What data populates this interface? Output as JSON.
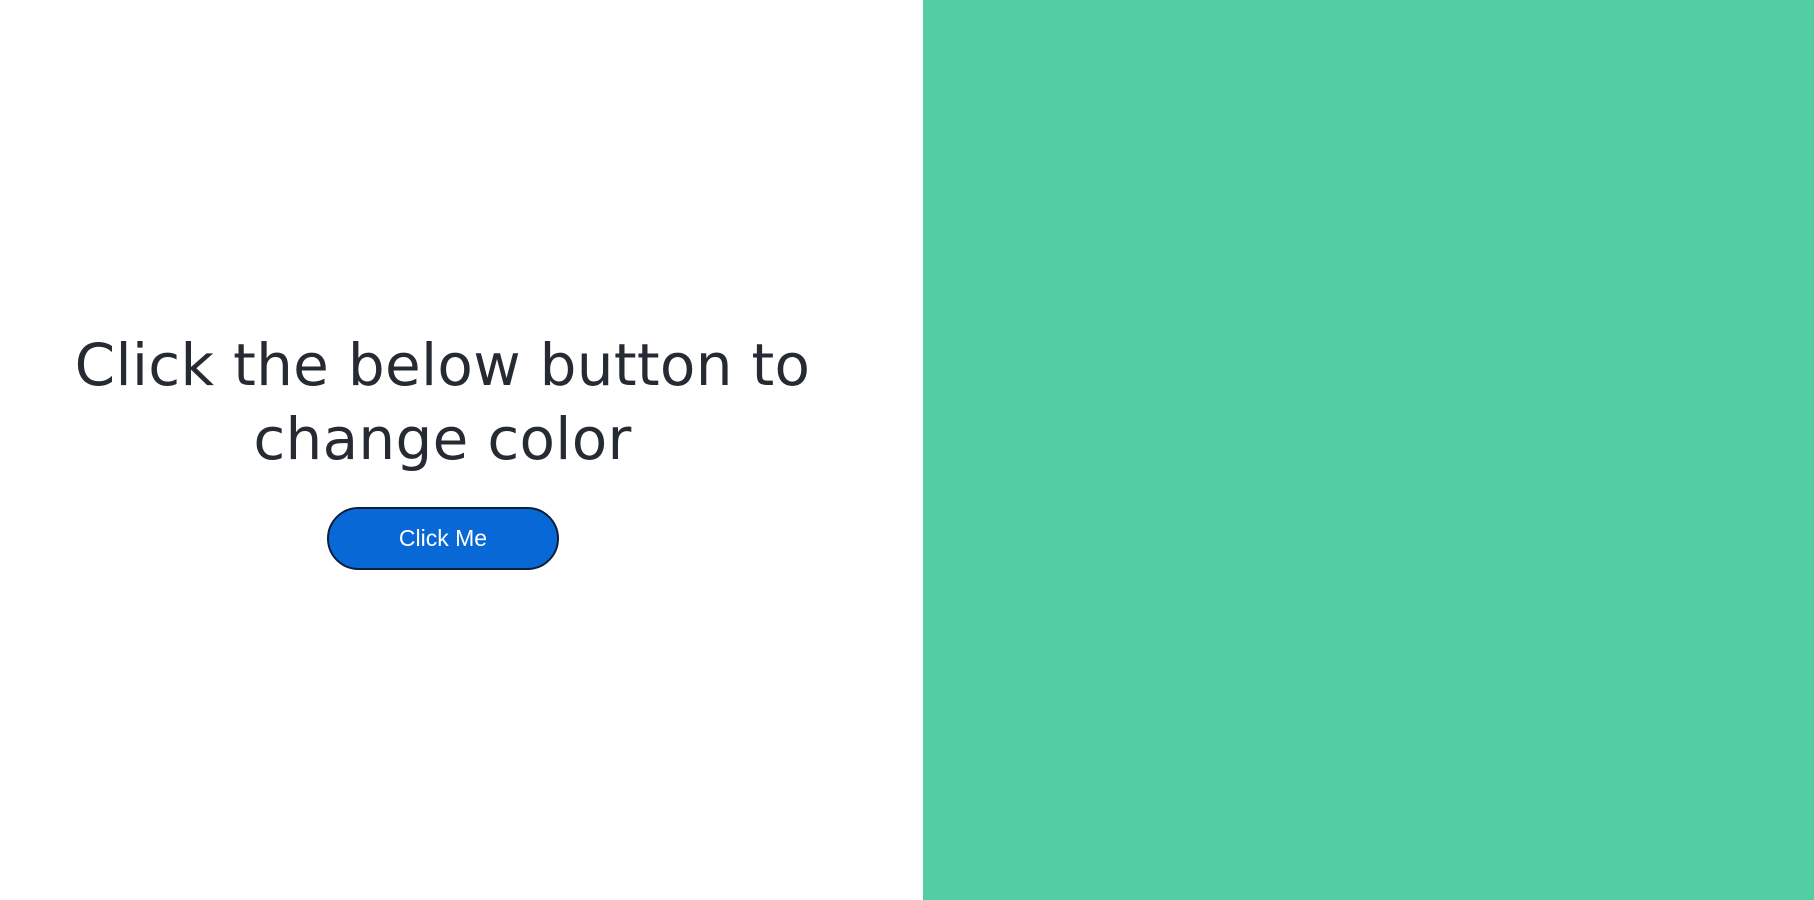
{
  "main": {
    "heading": "Click the below button to change color",
    "button_label": "Click Me"
  },
  "colors": {
    "panel_background": "#53cda3",
    "button_background": "#0868d6",
    "heading_text": "#262a33"
  }
}
